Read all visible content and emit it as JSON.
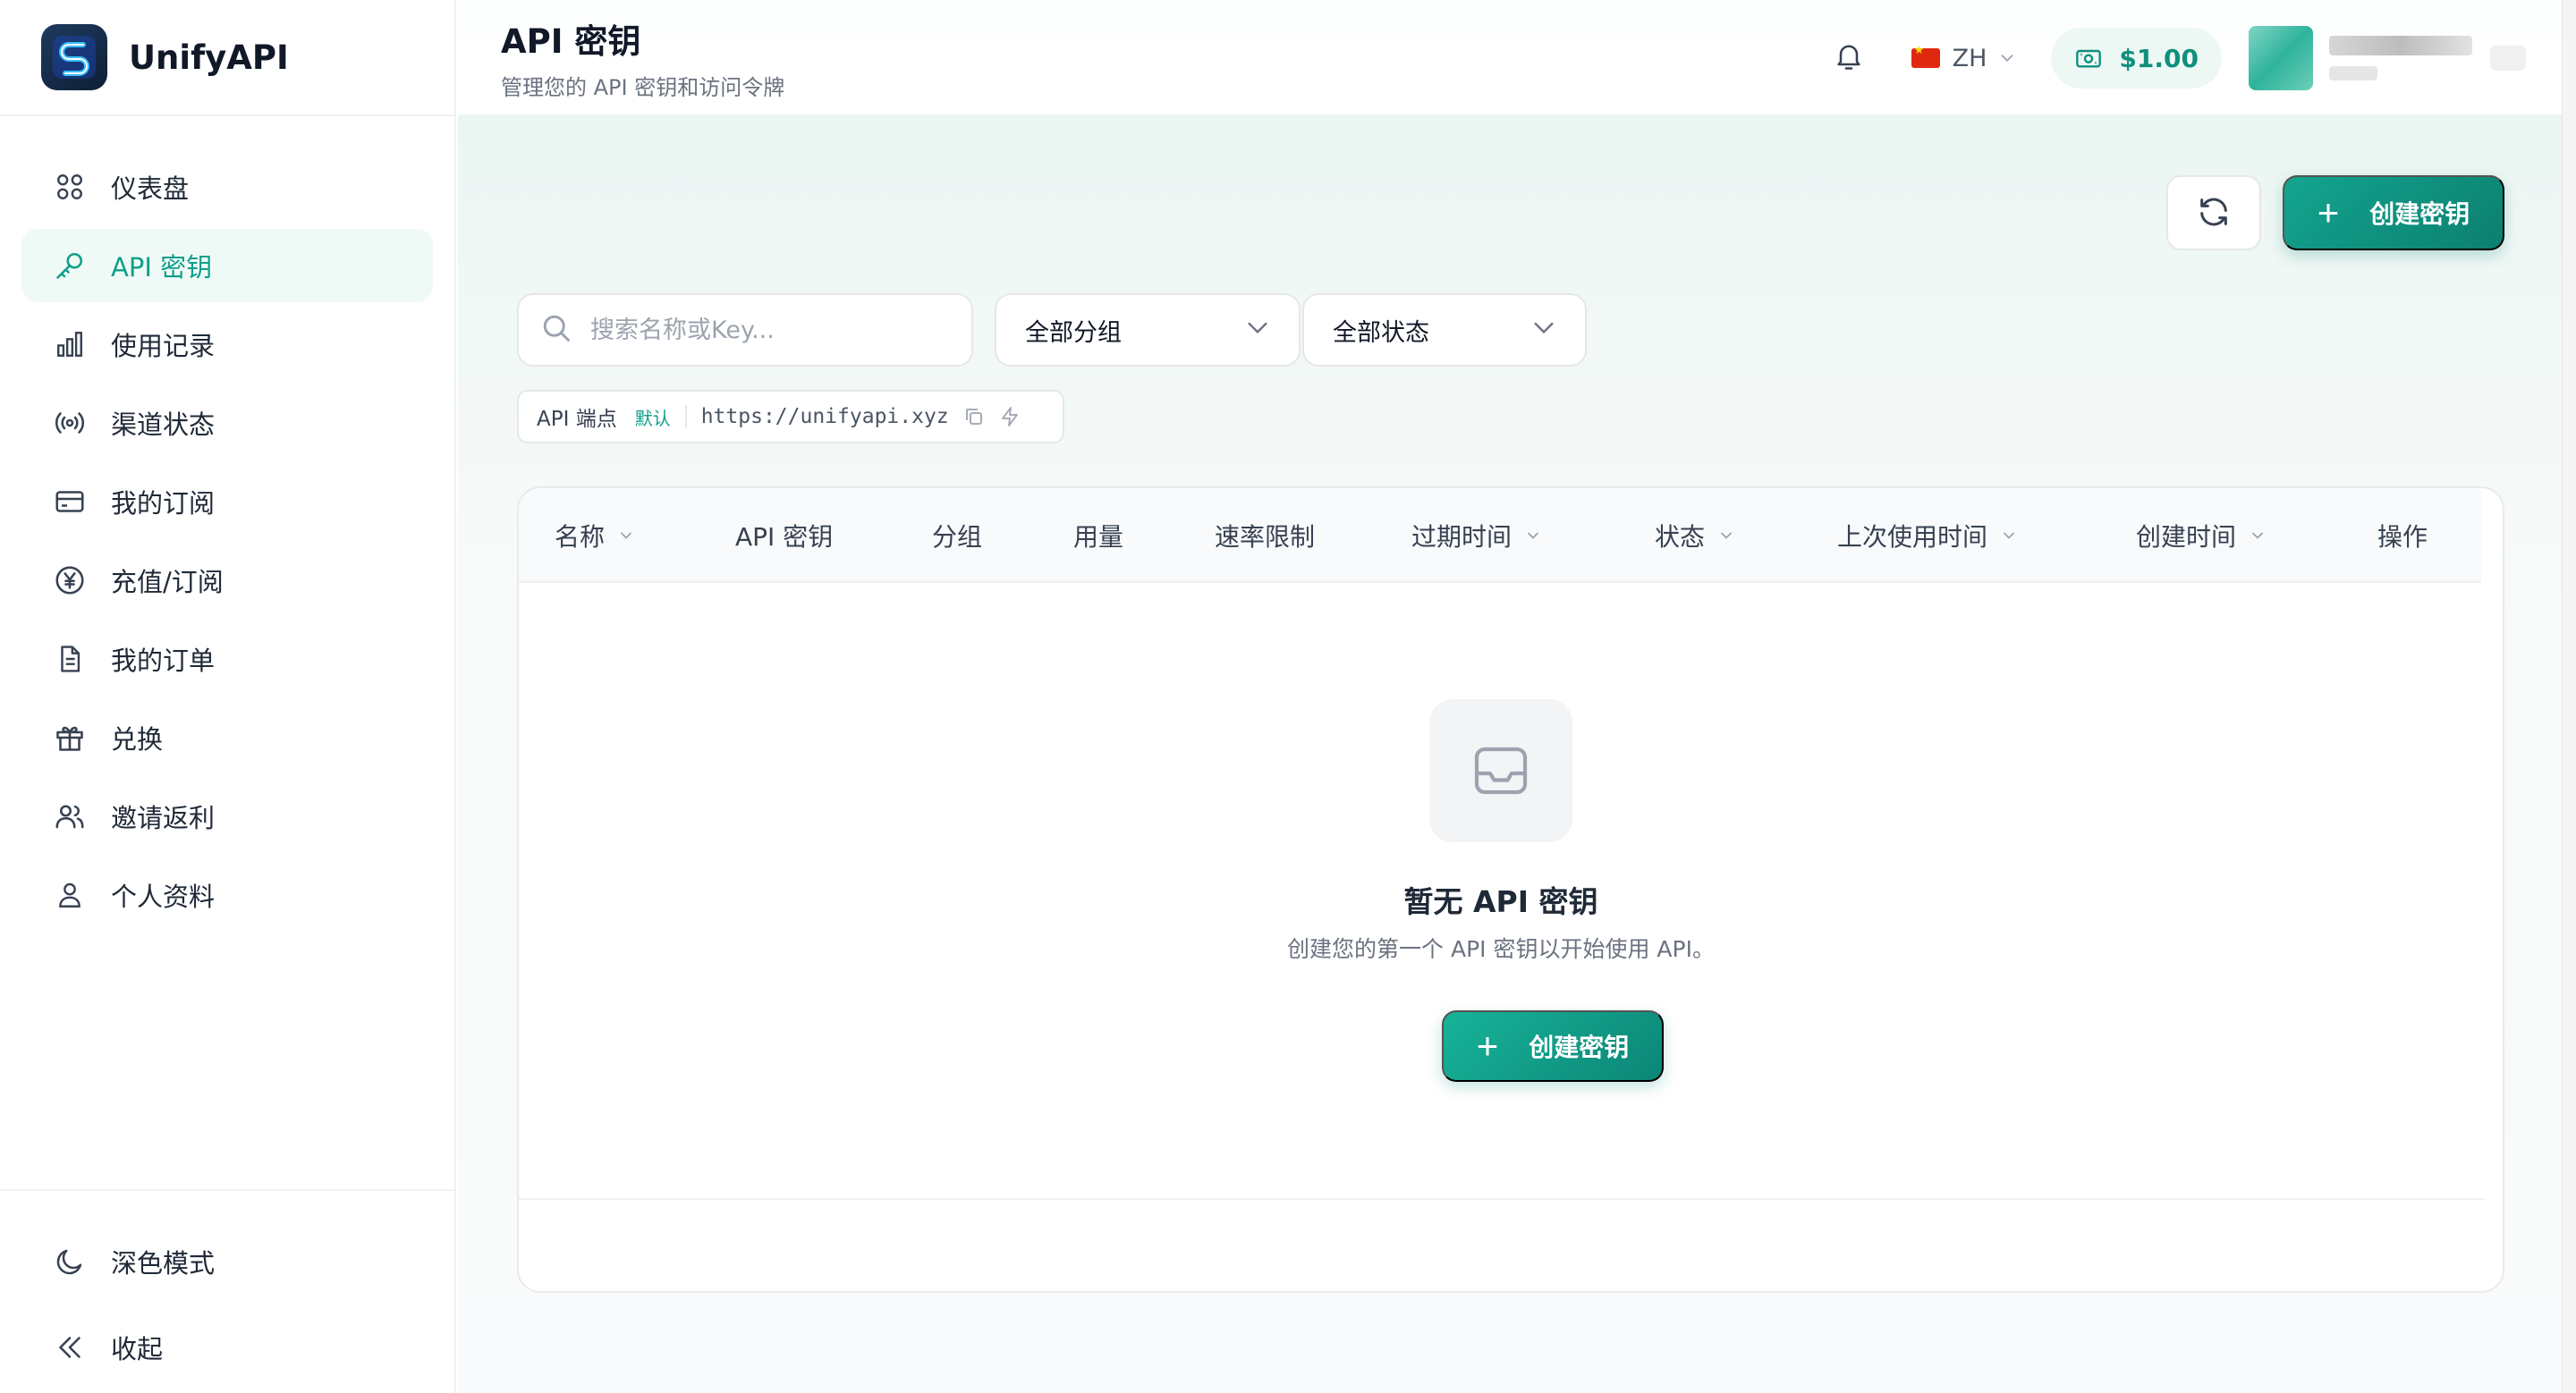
{
  "app": {
    "name": "UnifyAPI"
  },
  "sidebar": {
    "items": [
      {
        "label": "仪表盘",
        "icon": "dashboard-icon"
      },
      {
        "label": "API 密钥",
        "icon": "key-icon",
        "active": true
      },
      {
        "label": "使用记录",
        "icon": "bar-chart-icon"
      },
      {
        "label": "渠道状态",
        "icon": "broadcast-icon"
      },
      {
        "label": "我的订阅",
        "icon": "credit-card-icon"
      },
      {
        "label": "充值/订阅",
        "icon": "yen-circle-icon"
      },
      {
        "label": "我的订单",
        "icon": "document-icon"
      },
      {
        "label": "兑换",
        "icon": "gift-icon"
      },
      {
        "label": "邀请返利",
        "icon": "users-icon"
      },
      {
        "label": "个人资料",
        "icon": "user-icon"
      }
    ],
    "bottom": [
      {
        "label": "深色模式",
        "icon": "moon-icon"
      },
      {
        "label": "收起",
        "icon": "collapse-icon"
      }
    ]
  },
  "header": {
    "title": "API 密钥",
    "subtitle": "管理您的 API 密钥和访问令牌",
    "language": "ZH",
    "balance": "$1.00"
  },
  "toolbar": {
    "create_label": "创建密钥"
  },
  "filters": {
    "search_placeholder": "搜索名称或Key...",
    "group_value": "全部分组",
    "status_value": "全部状态"
  },
  "endpoint": {
    "label": "API 端点",
    "badge": "默认",
    "url": "https://unifyapi.xyz"
  },
  "table": {
    "columns": [
      {
        "label": "名称",
        "sortable": true
      },
      {
        "label": "API 密钥",
        "sortable": false
      },
      {
        "label": "分组",
        "sortable": false
      },
      {
        "label": "用量",
        "sortable": false
      },
      {
        "label": "速率限制",
        "sortable": false
      },
      {
        "label": "过期时间",
        "sortable": true
      },
      {
        "label": "状态",
        "sortable": true
      },
      {
        "label": "上次使用时间",
        "sortable": true
      },
      {
        "label": "创建时间",
        "sortable": true
      },
      {
        "label": "操作",
        "sortable": false
      }
    ],
    "rows": []
  },
  "empty_state": {
    "title": "暂无 API 密钥",
    "description": "创建您的第一个 API 密钥以开始使用 API。",
    "button_label": "创建密钥"
  },
  "colors": {
    "accent": "#0f9f8a",
    "accent_dark": "#0c7f70",
    "active_bg": "#effaf6"
  }
}
